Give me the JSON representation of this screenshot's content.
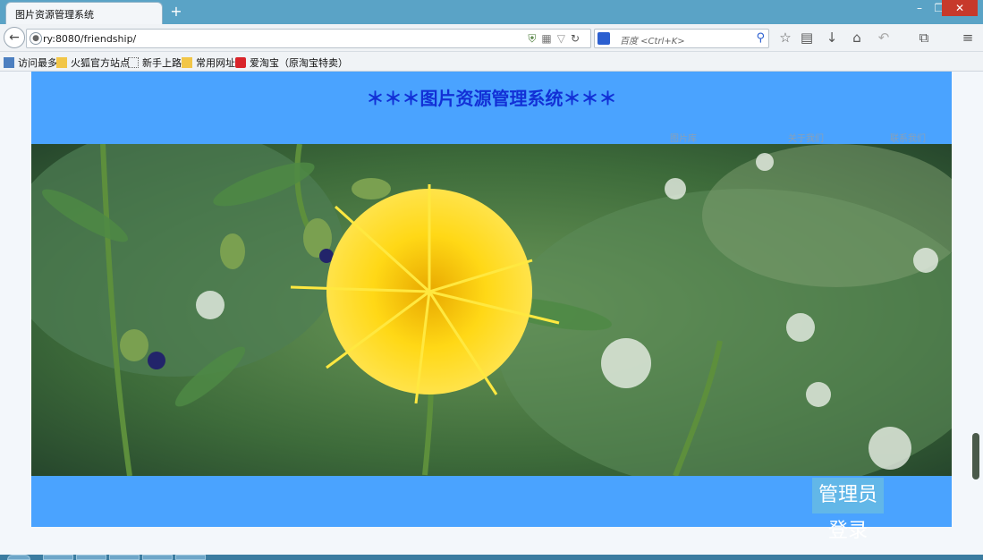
{
  "browser": {
    "tab_title": "图片资源管理系统",
    "new_tab": "+",
    "url": "ry:8080/friendship/",
    "search_placeholder": "百度 <Ctrl+K>",
    "win_minimize": "–",
    "win_restore": "❐",
    "win_close": "✕"
  },
  "bookmarks": [
    {
      "label": "访问最多",
      "icon": "bookmark-page-icon"
    },
    {
      "label": "火狐官方站点",
      "icon": "folder-icon"
    },
    {
      "label": "新手上路",
      "icon": "dotted-page-icon"
    },
    {
      "label": "常用网址",
      "icon": "folder-icon"
    },
    {
      "label": "爱淘宝（原淘宝特卖）",
      "icon": "taobao-icon"
    }
  ],
  "page": {
    "title": "＊＊＊图片资源管理系统＊＊＊",
    "nav": [
      "图片库",
      "关于我们",
      "联系我们"
    ],
    "admin_login": "管理员登录"
  },
  "colors": {
    "header_bg": "#4aa3ff",
    "title_color": "#1230d6",
    "titlebar": "#5aa3c6"
  }
}
